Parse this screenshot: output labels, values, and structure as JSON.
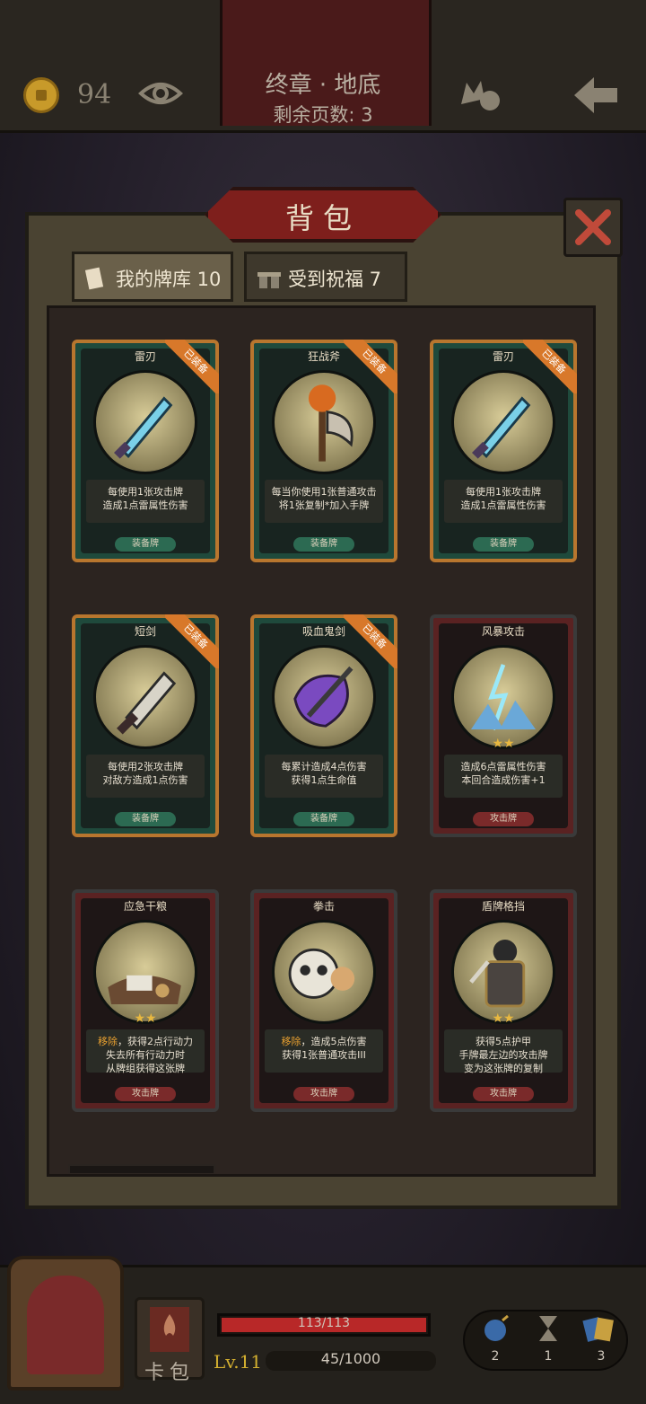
{
  "header": {
    "coins": "94",
    "chapter_title": "终章 · 地底",
    "pages_left": "剩余页数: 3"
  },
  "backpack": {
    "title": "背包",
    "tabs": [
      {
        "label": "我的牌库 10",
        "icon": "cards-icon"
      },
      {
        "label": "受到祝福 7",
        "icon": "gift-icon"
      }
    ]
  },
  "cards": [
    {
      "name": "雷刃",
      "kind": "equip",
      "badge": "已装备",
      "desc_lines": [
        "每使用1张攻击牌",
        "造成1点雷属性伤害"
      ],
      "type": "装备牌",
      "icon": "lightning-dagger-icon"
    },
    {
      "name": "狂战斧",
      "kind": "equip",
      "badge": "已装备",
      "desc_lines": [
        "每当你使用1张普通攻击",
        "将1张复制*加入手牌"
      ],
      "type": "装备牌",
      "icon": "pumpkin-axe-icon"
    },
    {
      "name": "雷刃",
      "kind": "equip",
      "badge": "已装备",
      "desc_lines": [
        "每使用1张攻击牌",
        "造成1点雷属性伤害"
      ],
      "type": "装备牌",
      "icon": "lightning-dagger-icon"
    },
    {
      "name": "短剑",
      "kind": "equip",
      "badge": "已装备",
      "desc_lines": [
        "每使用2张攻击牌",
        "对敌方造成1点伤害"
      ],
      "type": "装备牌",
      "icon": "short-sword-icon"
    },
    {
      "name": "吸血鬼剑",
      "kind": "equip",
      "badge": "已装备",
      "desc_lines": [
        "每累计造成4点伤害",
        "获得1点生命值"
      ],
      "type": "装备牌",
      "icon": "vampire-sword-icon"
    },
    {
      "name": "风暴攻击",
      "kind": "attack",
      "stars": "★★",
      "desc_lines": [
        "造成6点雷属性伤害",
        "本回合造成伤害+1"
      ],
      "type": "攻击牌",
      "icon": "storm-icon"
    },
    {
      "name": "应急干粮",
      "kind": "attack",
      "stars": "★★",
      "desc_prefix": "移除",
      "desc_lines": [
        "，获得2点行动力",
        "失去所有行动力时",
        "从牌组获得这张牌"
      ],
      "type": "攻击牌",
      "icon": "rations-icon"
    },
    {
      "name": "拳击",
      "kind": "attack",
      "desc_prefix": "移除",
      "desc_lines": [
        "，造成5点伤害",
        "获得1张普通攻击III"
      ],
      "type": "攻击牌",
      "icon": "punch-skull-icon"
    },
    {
      "name": "盾牌格挡",
      "kind": "attack",
      "stars": "★★",
      "desc_lines": [
        "获得5点护甲",
        "手牌最左边的攻击牌",
        "变为这张牌的复制"
      ],
      "type": "攻击牌",
      "icon": "shield-knight-icon"
    }
  ],
  "footer": {
    "deck_label": "卡包",
    "hp_text": "113/113",
    "hp_fraction": 1.0,
    "level": "Lv.11",
    "xp_text": "45/1000",
    "inventory": [
      {
        "icon": "bomb-icon",
        "count": "2"
      },
      {
        "icon": "hourglass-icon",
        "count": "1"
      },
      {
        "icon": "cards-stack-icon",
        "count": "3"
      }
    ]
  }
}
